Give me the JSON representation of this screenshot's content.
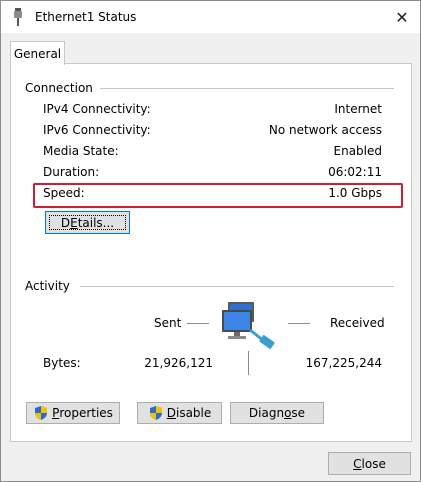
{
  "window": {
    "title": "Ethernet1 Status",
    "close_glyph": "✕"
  },
  "tabs": [
    {
      "label": "General"
    }
  ],
  "connection": {
    "title": "Connection",
    "rows": [
      {
        "label": "IPv4 Connectivity:",
        "value": "Internet"
      },
      {
        "label": "IPv6 Connectivity:",
        "value": "No network access"
      },
      {
        "label": "Media State:",
        "value": "Enabled"
      },
      {
        "label": "Duration:",
        "value": "06:02:11"
      },
      {
        "label": "Speed:",
        "value": "1.0 Gbps"
      }
    ],
    "details_button": {
      "mnemonic": "E",
      "pre": "D",
      "post": "tails..."
    },
    "highlight_color": "#cc1f2f"
  },
  "activity": {
    "title": "Activity",
    "sent_label": "Sent",
    "received_label": "Received",
    "bytes_label": "Bytes:",
    "bytes_sent": "21,926,121",
    "bytes_received": "167,225,244",
    "icon": "network-computers-icon"
  },
  "buttons": {
    "properties": {
      "mnemonic": "P",
      "rest": "roperties",
      "icon": "uac-shield-icon"
    },
    "disable": {
      "mnemonic": "D",
      "rest": "isable",
      "icon": "uac-shield-icon"
    },
    "diagnose": {
      "pre": "Diagn",
      "mnemonic": "o",
      "post": "se"
    },
    "close": {
      "mnemonic": "C",
      "rest": "lose"
    }
  }
}
